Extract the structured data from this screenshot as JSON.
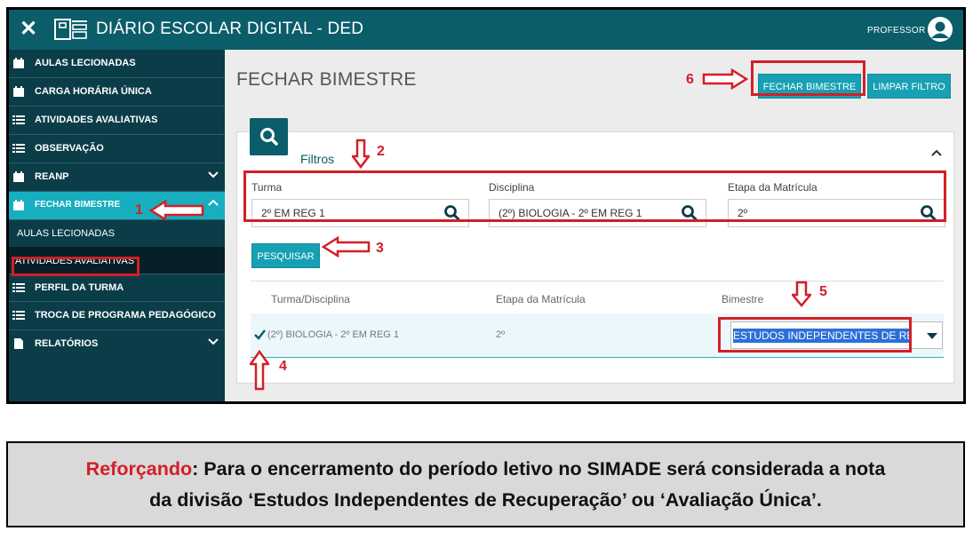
{
  "topbar": {
    "close_glyph": "✕",
    "title": "DIÁRIO ESCOLAR DIGITAL - DED",
    "user_label": "PROFESSOR"
  },
  "sidebar": {
    "items": [
      {
        "label": "AULAS LECIONADAS",
        "icon": "calendar-icon"
      },
      {
        "label": "CARGA HORÁRIA ÚNICA",
        "icon": "calendar-icon"
      },
      {
        "label": "ATIVIDADES AVALIATIVAS",
        "icon": "list-icon"
      },
      {
        "label": "OBSERVAÇÃO",
        "icon": "list-icon"
      },
      {
        "label": "REANP",
        "icon": "calendar-icon"
      },
      {
        "label": "FECHAR BIMESTRE",
        "icon": "calendar-icon"
      },
      {
        "label": "PERFIL DA TURMA",
        "icon": "list-icon"
      },
      {
        "label": "TROCA DE PROGRAMA PEDAGÓGICO",
        "icon": "list-icon"
      },
      {
        "label": "RELATÓRIOS",
        "icon": "document-icon"
      }
    ],
    "subitems": [
      "AULAS LECIONADAS",
      "ATIVIDADES AVALIATIVAS"
    ]
  },
  "main": {
    "page_title": "FECHAR BIMESTRE",
    "fechar_button": "FECHAR BIMESTRE",
    "limpar_button": "LIMPAR FILTRO",
    "filtros_label": "Filtros",
    "filters": [
      {
        "label": "Turma",
        "value": "2º EM REG 1"
      },
      {
        "label": "Disciplina",
        "value": "(2º) BIOLOGIA - 2º EM REG 1"
      },
      {
        "label": "Etapa da Matrícula",
        "value": "2º"
      }
    ],
    "pesquisar_button": "PESQUISAR",
    "table": {
      "headers": [
        "Turma/Disciplina",
        "Etapa da Matrícula",
        "Bimestre"
      ],
      "row": {
        "turma": "(2º) BIOLOGIA - 2º EM REG 1",
        "etapa": "2º",
        "bimestre": "ESTUDOS INDEPENDENTES DE RE"
      }
    }
  },
  "annotations": {
    "n1": "1",
    "n2": "2",
    "n3": "3",
    "n4": "4",
    "n5": "5",
    "n6": "6"
  },
  "note": {
    "highlight": "Reforçando",
    "line1": ": Para o encerramento do período letivo no SIMADE será considerada a nota",
    "line2": "da divisão ‘Estudos Independentes de Recuperação’ ou ‘Avaliação Única’."
  },
  "colors": {
    "topbar": "#0b5d6a",
    "sidebar": "#0b3d49",
    "active": "#17aebf",
    "button": "#17a0b3",
    "annotation": "#d41e26"
  }
}
